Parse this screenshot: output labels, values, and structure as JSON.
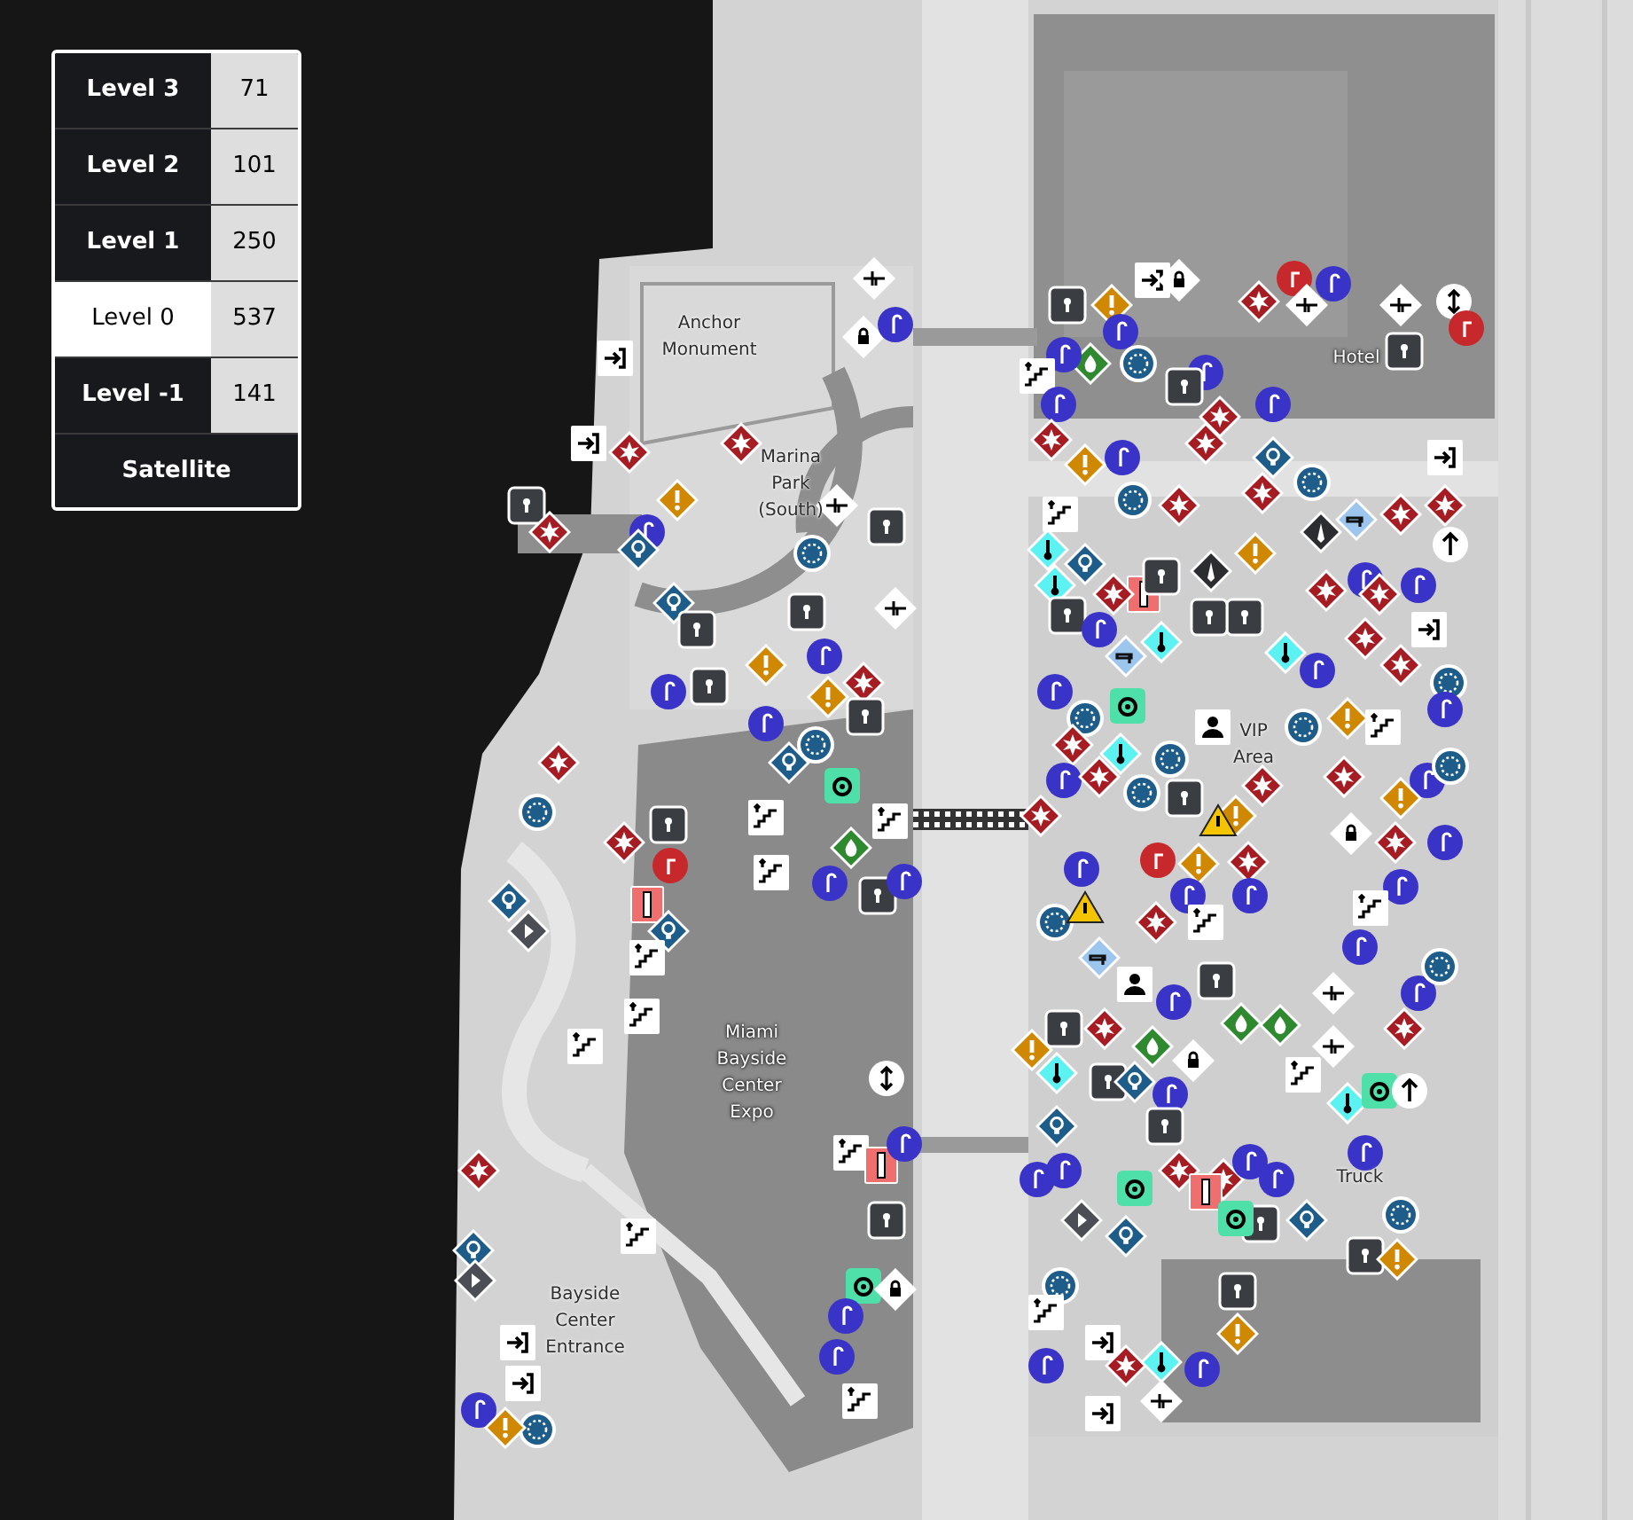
{
  "levels": [
    {
      "label": "Level 3",
      "count": "71",
      "selected": false
    },
    {
      "label": "Level 2",
      "count": "101",
      "selected": false
    },
    {
      "label": "Level 1",
      "count": "250",
      "selected": false
    },
    {
      "label": "Level 0",
      "count": "537",
      "selected": true
    },
    {
      "label": "Level -1",
      "count": "141",
      "selected": false
    }
  ],
  "satellite_button": "Satellite",
  "map_labels": [
    "Anchor Monument",
    "Marina Park (South)",
    "Hotel",
    "Miami Bayside Center Expo",
    "VIP Area",
    "Truck",
    "Bayside Center Entrance"
  ]
}
